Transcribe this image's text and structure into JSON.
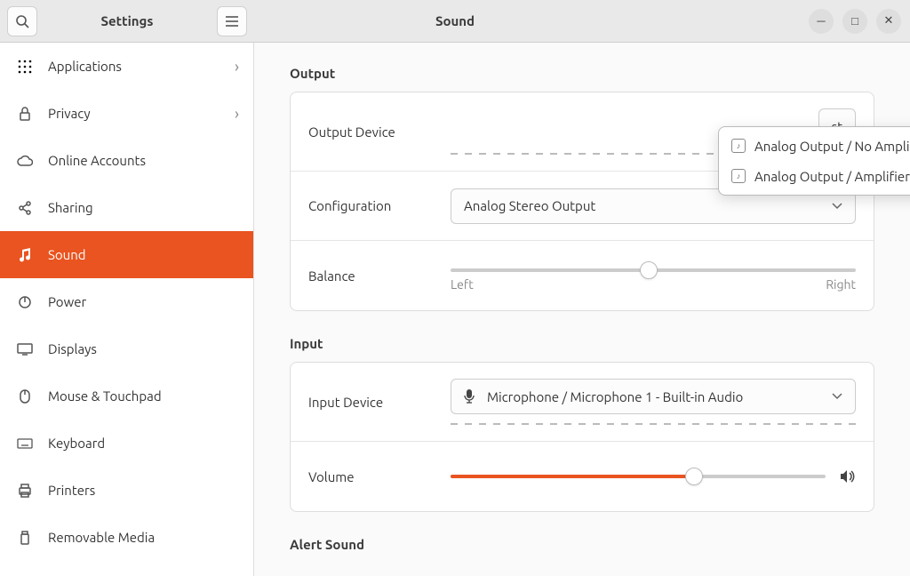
{
  "titlebar": {
    "sidebar_title": "Settings",
    "main_title": "Sound"
  },
  "sidebar": {
    "items": [
      {
        "icon": "grid",
        "label": "Applications",
        "chevron": true
      },
      {
        "icon": "lock",
        "label": "Privacy",
        "chevron": true
      },
      {
        "icon": "cloud",
        "label": "Online Accounts"
      },
      {
        "icon": "share",
        "label": "Sharing"
      },
      {
        "icon": "music",
        "label": "Sound",
        "active": true
      },
      {
        "icon": "power",
        "label": "Power"
      },
      {
        "icon": "display",
        "label": "Displays"
      },
      {
        "icon": "mouse",
        "label": "Mouse & Touchpad"
      },
      {
        "icon": "keyboard",
        "label": "Keyboard"
      },
      {
        "icon": "printer",
        "label": "Printers"
      },
      {
        "icon": "usb",
        "label": "Removable Media"
      }
    ]
  },
  "sections": {
    "output": {
      "title": "Output",
      "device_label": "Output Device",
      "test_label": "st",
      "config_label": "Configuration",
      "config_value": "Analog Stereo Output",
      "balance_label": "Balance",
      "balance_left": "Left",
      "balance_right": "Right",
      "balance_percent": 49
    },
    "input": {
      "title": "Input",
      "device_label": "Input Device",
      "device_value": "Microphone / Microphone 1 - Built-in Audio",
      "volume_label": "Volume",
      "volume_percent": 65
    },
    "alert": {
      "title": "Alert Sound"
    }
  },
  "dropdown": {
    "items": [
      "Analog Output / No Amplifier - Built-in Audio",
      "Analog Output / Amplifier - Built-in Audio"
    ]
  }
}
